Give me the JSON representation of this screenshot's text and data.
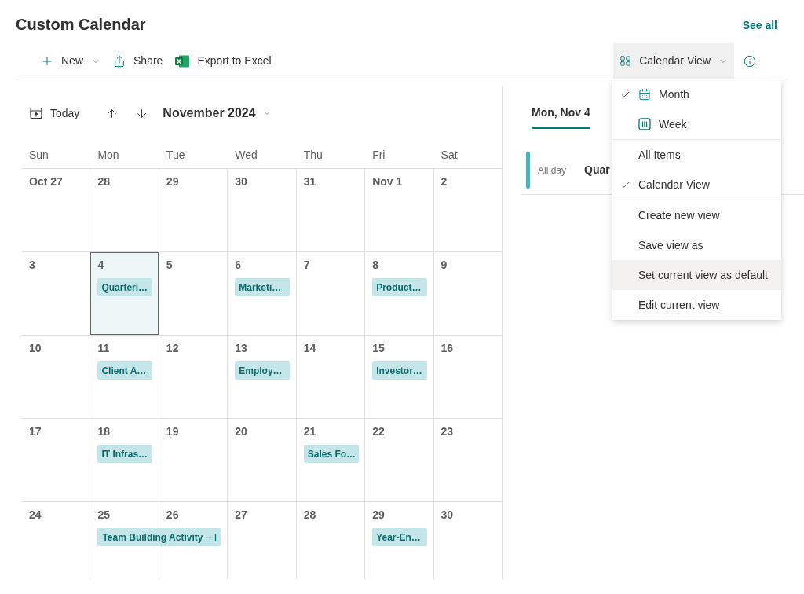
{
  "header": {
    "title": "Custom Calendar",
    "link": "See all"
  },
  "toolbar": {
    "commands": [
      {
        "kind": "new",
        "label": "New",
        "menu": true
      },
      {
        "kind": "share",
        "label": "Share",
        "menu": false
      },
      {
        "kind": "export",
        "label": "Export to Excel",
        "menu": false
      }
    ],
    "view_button": {
      "label": "Calendar View",
      "expanded": true,
      "menu": {
        "groups": [
          {
            "items": [
              {
                "kind": "month",
                "label": "Month",
                "checked": true,
                "highlighted": false
              },
              {
                "kind": "week",
                "label": "Week",
                "checked": false,
                "highlighted": false
              }
            ]
          },
          {
            "items": [
              {
                "kind": "text",
                "label": "All Items",
                "checked": false,
                "highlighted": false
              },
              {
                "kind": "text",
                "label": "Calendar View",
                "checked": true,
                "highlighted": false
              }
            ]
          },
          {
            "items": [
              {
                "kind": "text",
                "label": "Create new view",
                "checked": false,
                "highlighted": false
              },
              {
                "kind": "text",
                "label": "Save view as",
                "checked": false,
                "highlighted": false
              },
              {
                "kind": "text",
                "label": "Set current view as default",
                "checked": false,
                "highlighted": true
              },
              {
                "kind": "text",
                "label": "Edit current view",
                "checked": false,
                "highlighted": false
              }
            ]
          }
        ]
      }
    }
  },
  "calendar": {
    "today": "Today",
    "month": "November 2024",
    "weekdays": [
      "Sun",
      "Mon",
      "Tue",
      "Wed",
      "Thu",
      "Fri",
      "Sat"
    ],
    "weeks": [
      {
        "days": [
          {
            "date": "Oct 27",
            "selected": false
          },
          {
            "date": "28",
            "selected": false
          },
          {
            "date": "29",
            "selected": false
          },
          {
            "date": "30",
            "selected": false
          },
          {
            "date": "31",
            "selected": false
          },
          {
            "date": "Nov 1",
            "selected": false
          },
          {
            "date": "2",
            "selected": false
          }
        ]
      },
      {
        "days": [
          {
            "date": "3",
            "selected": false
          },
          {
            "date": "4",
            "selected": true,
            "events": [
              {
                "title": "Quarterl…",
                "continues": false
              }
            ]
          },
          {
            "date": "5",
            "selected": false
          },
          {
            "date": "6",
            "selected": false,
            "events": [
              {
                "title": "Marketi…",
                "continues": false
              }
            ]
          },
          {
            "date": "7",
            "selected": false
          },
          {
            "date": "8",
            "selected": false,
            "events": [
              {
                "title": "Product…",
                "continues": false
              }
            ]
          },
          {
            "date": "9",
            "selected": false
          }
        ]
      },
      {
        "days": [
          {
            "date": "10",
            "selected": false
          },
          {
            "date": "11",
            "selected": false,
            "events": [
              {
                "title": "Client A…",
                "continues": false
              }
            ]
          },
          {
            "date": "12",
            "selected": false
          },
          {
            "date": "13",
            "selected": false,
            "events": [
              {
                "title": "Employ…",
                "continues": false
              }
            ]
          },
          {
            "date": "14",
            "selected": false
          },
          {
            "date": "15",
            "selected": false,
            "events": [
              {
                "title": "Investor…",
                "continues": false
              }
            ]
          },
          {
            "date": "16",
            "selected": false
          }
        ]
      },
      {
        "days": [
          {
            "date": "17",
            "selected": false
          },
          {
            "date": "18",
            "selected": false,
            "events": [
              {
                "title": "IT Infras…",
                "continues": false
              }
            ]
          },
          {
            "date": "19",
            "selected": false
          },
          {
            "date": "20",
            "selected": false
          },
          {
            "date": "21",
            "selected": false,
            "events": [
              {
                "title": "Sales Fo…",
                "continues": false
              }
            ]
          },
          {
            "date": "22",
            "selected": false
          },
          {
            "date": "23",
            "selected": false
          }
        ]
      },
      {
        "days": [
          {
            "date": "24",
            "selected": false
          },
          {
            "date": "25",
            "selected": false,
            "events": [
              {
                "title": "Team Building Activity",
                "continues": true
              }
            ]
          },
          {
            "date": "26",
            "selected": false
          },
          {
            "date": "27",
            "selected": false
          },
          {
            "date": "28",
            "selected": false
          },
          {
            "date": "29",
            "selected": false,
            "events": [
              {
                "title": "Year-En…",
                "continues": false
              }
            ]
          },
          {
            "date": "30",
            "selected": false
          }
        ]
      }
    ]
  },
  "day_panel": {
    "tabs": [
      {
        "label": "Mon, Nov 4",
        "selected": true
      }
    ],
    "events": [
      {
        "time": "All day",
        "title": "Quar"
      }
    ]
  }
}
